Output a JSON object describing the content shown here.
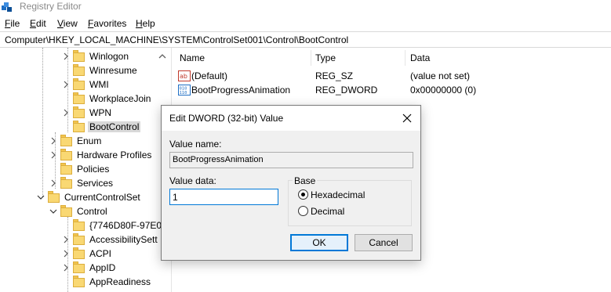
{
  "window": {
    "title": "Registry Editor"
  },
  "menu": [
    "File",
    "Edit",
    "View",
    "Favorites",
    "Help"
  ],
  "address": "Computer\\HKEY_LOCAL_MACHINE\\SYSTEM\\ControlSet001\\Control\\BootControl",
  "tree": [
    {
      "label": "Winlogon",
      "expandable": true,
      "selected": false
    },
    {
      "label": "Winresume",
      "expandable": false,
      "selected": false
    },
    {
      "label": "WMI",
      "expandable": true,
      "selected": false
    },
    {
      "label": "WorkplaceJoin",
      "expandable": false,
      "selected": false
    },
    {
      "label": "WPN",
      "expandable": true,
      "selected": false
    },
    {
      "label": "BootControl",
      "expandable": false,
      "selected": true
    },
    {
      "label": "Enum",
      "expandable": true,
      "selected": false
    },
    {
      "label": "Hardware Profiles",
      "expandable": true,
      "selected": false
    },
    {
      "label": "Policies",
      "expandable": false,
      "selected": false
    },
    {
      "label": "Services",
      "expandable": true,
      "selected": false
    },
    {
      "label": "CurrentControlSet",
      "expanded": true,
      "selected": false
    },
    {
      "label": "Control",
      "expanded": true,
      "selected": false
    },
    {
      "label": "{7746D80F-97E0",
      "expandable": false,
      "selected": false
    },
    {
      "label": "AccessibilitySett",
      "expandable": true,
      "selected": false
    },
    {
      "label": "ACPI",
      "expandable": true,
      "selected": false
    },
    {
      "label": "AppID",
      "expandable": true,
      "selected": false
    },
    {
      "label": "AppReadiness",
      "expandable": false,
      "selected": false
    }
  ],
  "list": {
    "columns": [
      "Name",
      "Type",
      "Data"
    ],
    "rows": [
      {
        "icon": "string-value-icon",
        "name": "(Default)",
        "type": "REG_SZ",
        "data": "(value not set)"
      },
      {
        "icon": "binary-value-icon",
        "name": "BootProgressAnimation",
        "type": "REG_DWORD",
        "data": "0x00000000 (0)"
      }
    ]
  },
  "dialog": {
    "title": "Edit DWORD (32-bit) Value",
    "value_name_label": "Value name:",
    "value_name": "BootProgressAnimation",
    "value_data_label": "Value data:",
    "value_data": "1",
    "base_label": "Base",
    "base_options": [
      {
        "label": "Hexadecimal",
        "checked": true
      },
      {
        "label": "Decimal",
        "checked": false
      }
    ],
    "ok_label": "OK",
    "cancel_label": "Cancel"
  },
  "colors": {
    "folder": "#f9d873",
    "accent": "#0078d7",
    "selection": "#d9d9d9"
  }
}
